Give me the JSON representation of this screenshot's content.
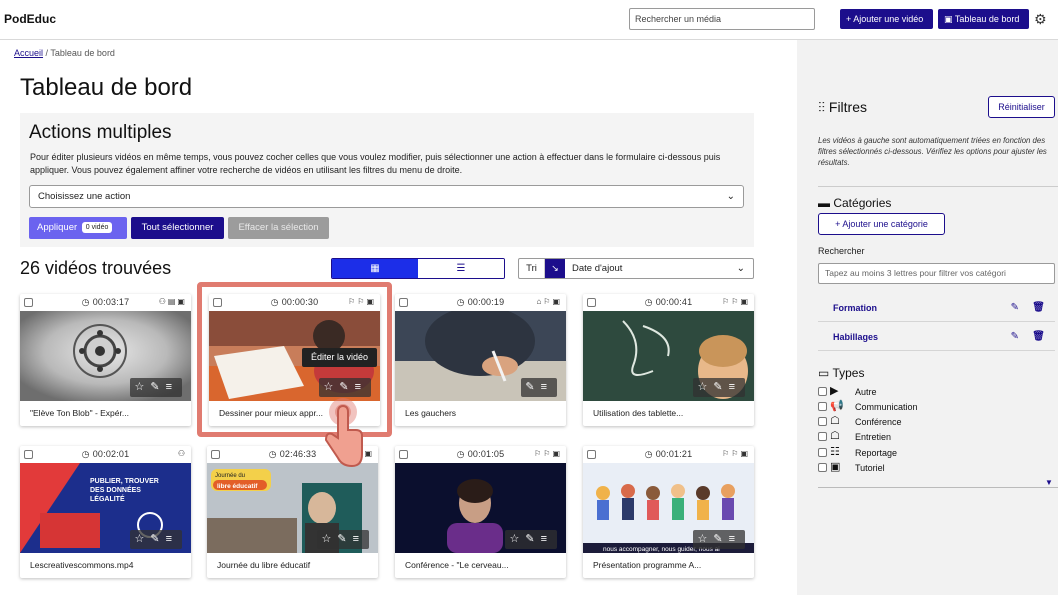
{
  "header": {
    "brand": "PodEduc",
    "search_placeholder": "Rechercher un média",
    "add_video": "+ Ajouter une vidéo",
    "dashboard": "Tableau de bord"
  },
  "breadcrumb": {
    "home": "Accueil",
    "separator": "/",
    "current": "Tableau de bord"
  },
  "page_title": "Tableau de bord",
  "actions": {
    "title": "Actions multiples",
    "description": "Pour éditer plusieurs vidéos en même temps, vous pouvez cocher celles que vous voulez modifier, puis sélectionner une action à effectuer dans le formulaire ci-dessous puis appliquer. Vous pouvez également affiner votre recherche de vidéos en utilisant les filtres du menu de droite.",
    "select_placeholder": "Choisissez une action",
    "apply": "Appliquer",
    "apply_badge": "0 vidéo",
    "select_all": "Tout sélectionner",
    "clear_selection": "Effacer la sélection"
  },
  "results": {
    "count_title": "26 vidéos trouvées",
    "sort_label": "Tri",
    "sort_value": "Date d'ajout"
  },
  "videos": [
    {
      "duration": "00:03:17",
      "title": "\"Elève Ton Blob\" - Expér..."
    },
    {
      "duration": "00:00:30",
      "title": "Dessiner pour mieux appr..."
    },
    {
      "duration": "00:00:19",
      "title": "Les gauchers"
    },
    {
      "duration": "00:00:41",
      "title": "Utilisation des tablette..."
    },
    {
      "duration": "00:02:01",
      "title": "Lescreativescommons.mp4"
    },
    {
      "duration": "02:46:33",
      "title": "Journée du libre éducatif"
    },
    {
      "duration": "00:01:05",
      "title": "Conférence - \"Le cerveau..."
    },
    {
      "duration": "00:01:21",
      "title": "Présentation programme A..."
    }
  ],
  "thumb_texts": {
    "v5_line1": "PUBLIER, TROUVER",
    "v5_line2": "DES DONNÉES",
    "v5_line3": "LÉGALITÉ",
    "v6_line1": "Journée du",
    "v6_line2": "libre éducatif",
    "v8_caption": "nous accompagner, nous guider, nous ai"
  },
  "tooltip": "Éditer la vidéo",
  "sidebar": {
    "filters_title": "Filtres",
    "reset": "Réinitialiser",
    "note": "Les vidéos à gauche sont automatiquement triées en fonction des filtres sélectionnés ci-dessous. Vérifiez les options pour ajuster les résultats.",
    "categories_title": "Catégories",
    "add_category": "+ Ajouter une catégorie",
    "search_label": "Rechercher",
    "search_placeholder": "Tapez au moins 3 lettres pour filtrer vos catégori",
    "categories": [
      "Formation",
      "Habillages"
    ],
    "types_title": "Types",
    "types": [
      "Autre",
      "Communication",
      "Conférence",
      "Entretien",
      "Reportage",
      "Tutoriel"
    ]
  },
  "colors": {
    "primary": "#1c0e8c",
    "apply": "#6b63ef",
    "highlight": "#e07b70"
  }
}
